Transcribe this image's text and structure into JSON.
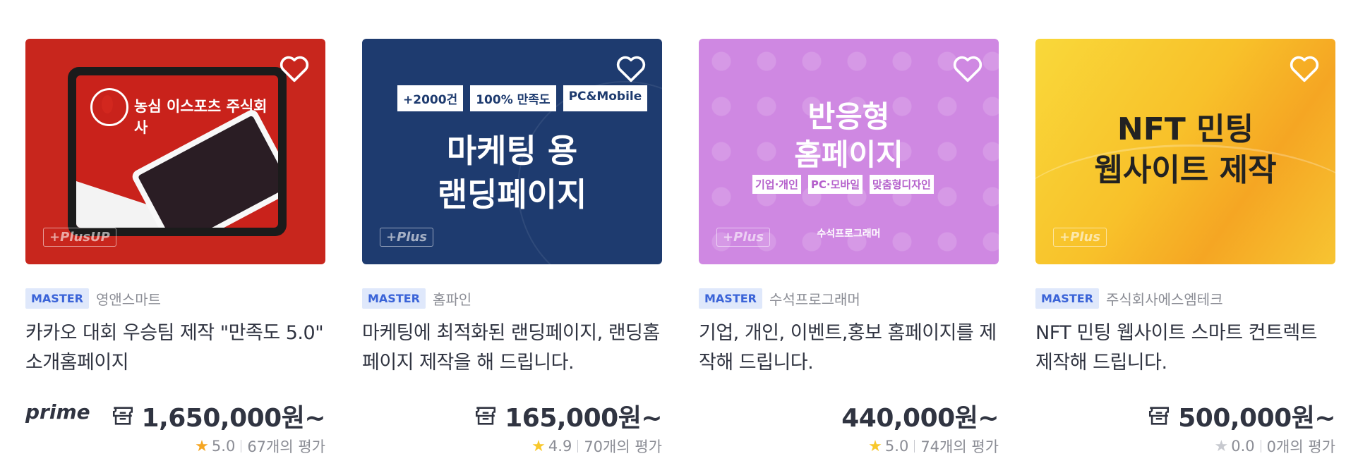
{
  "cards": [
    {
      "thumb": {
        "company": "농심 이스포츠 주식회사",
        "plus_tag": "+PlusUP"
      },
      "badge": "MASTER",
      "seller": "영앤스마트",
      "title_line1": "카카오 대회 우승팀 제작 \"만족도 5.0\"",
      "title_line2": "소개홈페이지",
      "prime": "prime",
      "price": "1,650,000원~",
      "rating": "5.0",
      "reviews": "67개의 평가",
      "star_color": "#f5a623",
      "has_coupon": true
    },
    {
      "thumb": {
        "pills": [
          "+2000건",
          "100% 만족도",
          "PC&Mobile"
        ],
        "headline1": "마케팅 용",
        "headline2": "랜딩페이지",
        "plus_tag": "+Plus"
      },
      "badge": "MASTER",
      "seller": "홈파인",
      "title_line1": "마케팅에 최적화된 랜딩페이지, 랜딩홈",
      "title_line2": "페이지 제작을 해 드립니다.",
      "price": "165,000원~",
      "rating": "4.9",
      "reviews": "70개의 평가",
      "star_color": "#f8c82c",
      "has_coupon": true
    },
    {
      "thumb": {
        "headline1": "반응형",
        "headline2": "홈페이지",
        "tags": [
          "기업·개인",
          "PC·모바일",
          "맞춤형디자인"
        ],
        "author": "수석프로그래머",
        "plus_tag": "+Plus"
      },
      "badge": "MASTER",
      "seller": "수석프로그래머",
      "title_line1": "기업, 개인, 이벤트,홍보 홈페이지를 제",
      "title_line2": "작해 드립니다.",
      "price": "440,000원~",
      "rating": "5.0",
      "reviews": "74개의 평가",
      "star_color": "#f8c82c",
      "has_coupon": false
    },
    {
      "thumb": {
        "headline1": "NFT 민팅",
        "headline2": "웹사이트 제작",
        "plus_tag": "+Plus"
      },
      "badge": "MASTER",
      "seller": "주식회사에스엠테크",
      "title_line1": "NFT 민팅 웹사이트 스마트 컨트렉트",
      "title_line2": "제작해 드립니다.",
      "price": "500,000원~",
      "rating": "0.0",
      "reviews": "0개의 평가",
      "star_color": "#c7c9cf",
      "has_coupon": true
    }
  ],
  "icons": {
    "heart": "heart-outline-icon",
    "coupon": "coupon-icon",
    "star": "star-icon"
  }
}
